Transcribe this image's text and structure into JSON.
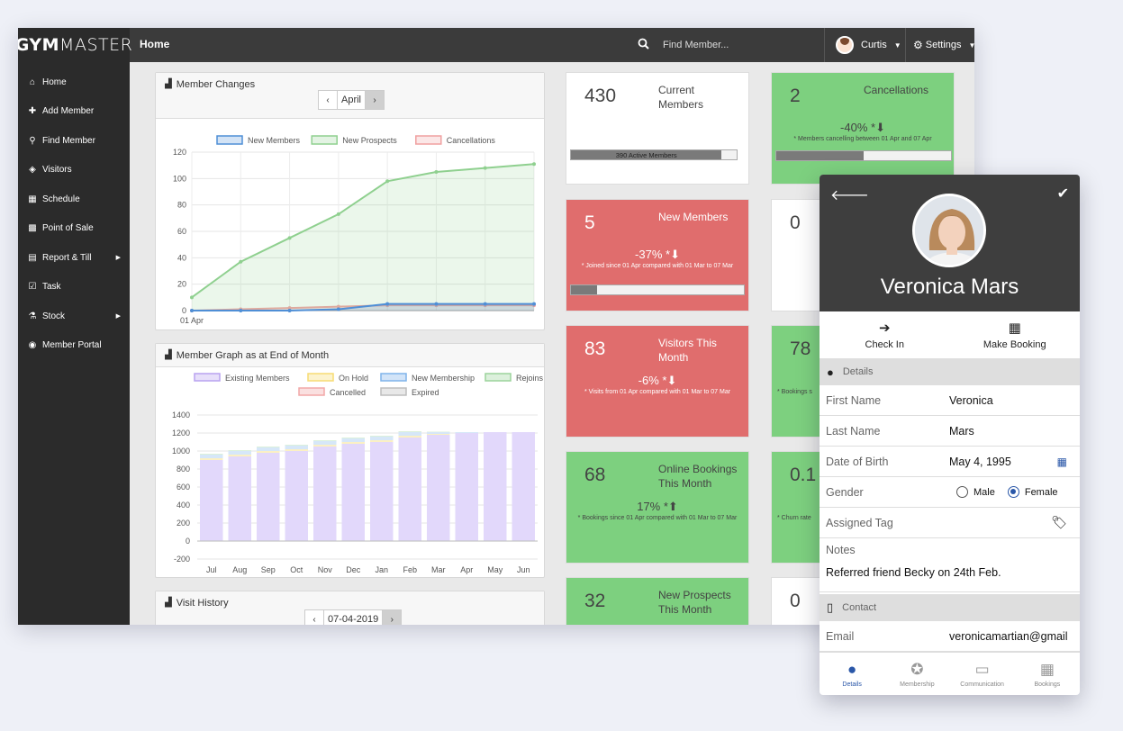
{
  "app": {
    "logo_bold": "GYM",
    "logo_light": "MASTER",
    "page_title": "Home",
    "search_placeholder": "Find Member...",
    "user_name": "Curtis",
    "settings_label": "Settings"
  },
  "sidebar": {
    "items": [
      {
        "label": "Home",
        "icon": "home-icon",
        "glyph": "⌂"
      },
      {
        "label": "Add Member",
        "icon": "plus-icon",
        "glyph": "✚"
      },
      {
        "label": "Find Member",
        "icon": "search-icon",
        "glyph": "⚲"
      },
      {
        "label": "Visitors",
        "icon": "tags-icon",
        "glyph": "◈"
      },
      {
        "label": "Schedule",
        "icon": "calendar-icon",
        "glyph": "▦"
      },
      {
        "label": "Point of Sale",
        "icon": "grid-icon",
        "glyph": "▩"
      },
      {
        "label": "Report & Till",
        "icon": "printer-icon",
        "glyph": "▤"
      },
      {
        "label": "Task",
        "icon": "checkbox-icon",
        "glyph": "☑"
      },
      {
        "label": "Stock",
        "icon": "flask-icon",
        "glyph": "⚗"
      },
      {
        "label": "Member Portal",
        "icon": "globe-icon",
        "glyph": "◉"
      }
    ]
  },
  "member_changes": {
    "title": "Member Changes",
    "month": "April"
  },
  "member_graph": {
    "title": "Member Graph as at End of Month"
  },
  "visit_history": {
    "title": "Visit History",
    "date": "07-04-2019"
  },
  "cards": {
    "current": {
      "value": "430",
      "label": "Current Members",
      "bar_text": "390  Active Members",
      "bar_fraction": 0.91
    },
    "cancellations": {
      "value": "2",
      "label": "Cancellations",
      "pct": "-40% *",
      "note": "* Members cancelling between 01 Apr and 07 Apr",
      "bar_fraction": 0.5
    },
    "new_members": {
      "value": "5",
      "label": "New Members",
      "pct": "-37% *",
      "note": "* Joined since 01 Apr compared with 01 Mar to 07 Mar",
      "bar_fraction": 0.15
    },
    "visitors": {
      "value": "83",
      "label": "Visitors This Month",
      "pct": "-6% *",
      "note": "* Visits from 01 Apr compared with 01 Mar to 07 Mar"
    },
    "online": {
      "value": "68",
      "label": "Online Bookings This Month",
      "pct": "17% *",
      "note": "* Bookings since 01 Apr compared with 01 Mar to 07 Mar"
    },
    "prospects": {
      "value": "32",
      "label": "New Prospects This Month"
    },
    "col3_r2": {
      "value": "0"
    },
    "col3_r3": {
      "value": "78",
      "note": "* Bookings s"
    },
    "col3_r4": {
      "value": "0.1",
      "note": "* Churn rate"
    },
    "col3_r5": {
      "value": "0"
    }
  },
  "phone": {
    "name": "Veronica Mars",
    "actions": {
      "check_in": "Check In",
      "make_booking": "Make Booking"
    },
    "details_header": "Details",
    "fields": {
      "first_name_label": "First Name",
      "first_name": "Veronica",
      "last_name_label": "Last Name",
      "last_name": "Mars",
      "dob_label": "Date of Birth",
      "dob": "May 4, 1995",
      "gender_label": "Gender",
      "male": "Male",
      "female": "Female",
      "tag_label": "Assigned Tag",
      "notes_label": "Notes",
      "notes": "Referred friend Becky on 24th Feb."
    },
    "contact_header": "Contact",
    "email_label": "Email",
    "email": "veronicamartian@gmail",
    "tabs": {
      "details": "Details",
      "membership": "Membership",
      "communication": "Communication",
      "bookings": "Bookings"
    }
  },
  "chart_data": [
    {
      "type": "area",
      "title": "",
      "x": [
        "01 Apr",
        "",
        "",
        "",
        "",
        "",
        "",
        ""
      ],
      "ylim": [
        0,
        120
      ],
      "yticks": [
        0,
        20,
        40,
        60,
        80,
        100,
        120
      ],
      "series": [
        {
          "name": "New Members",
          "color": "#4f8fd6",
          "values": [
            0,
            0,
            0,
            1,
            5,
            5,
            5,
            5
          ]
        },
        {
          "name": "New Prospects",
          "color": "#8fd08f",
          "values": [
            10,
            37,
            55,
            73,
            98,
            105,
            108,
            111
          ]
        },
        {
          "name": "Cancellations",
          "color": "#f0a1a1",
          "values": [
            0,
            1,
            2,
            3,
            4,
            4,
            4,
            4
          ]
        }
      ]
    },
    {
      "type": "bar",
      "title": "",
      "categories": [
        "Jul",
        "Aug",
        "Sep",
        "Oct",
        "Nov",
        "Dec",
        "Jan",
        "Feb",
        "Mar",
        "Apr",
        "May",
        "Jun"
      ],
      "ylim": [
        -200,
        1400
      ],
      "yticks": [
        -200,
        0,
        200,
        400,
        600,
        800,
        1000,
        1200,
        1400
      ],
      "legend": [
        {
          "name": "Existing Members",
          "color": "#b9a2f0"
        },
        {
          "name": "On Hold",
          "color": "#f7dc74"
        },
        {
          "name": "New Membership",
          "color": "#7fb3ea"
        },
        {
          "name": "Rejoins",
          "color": "#9cd49c"
        },
        {
          "name": "Cancelled",
          "color": "#f2a7a7"
        },
        {
          "name": "Expired",
          "color": "#bdbdbd"
        }
      ],
      "series": [
        {
          "name": "Existing Members",
          "values": [
            900,
            940,
            980,
            1000,
            1050,
            1080,
            1100,
            1150,
            1180,
            1200,
            1210,
            1210
          ]
        },
        {
          "name": "On Hold",
          "values": [
            20,
            20,
            20,
            20,
            20,
            20,
            20,
            20,
            10,
            0,
            0,
            0
          ]
        },
        {
          "name": "New Membership",
          "values": [
            40,
            40,
            40,
            40,
            40,
            40,
            40,
            40,
            20,
            10,
            0,
            0
          ]
        },
        {
          "name": "Rejoins",
          "values": [
            10,
            10,
            10,
            10,
            10,
            10,
            10,
            10,
            5,
            0,
            0,
            0
          ]
        }
      ]
    }
  ]
}
